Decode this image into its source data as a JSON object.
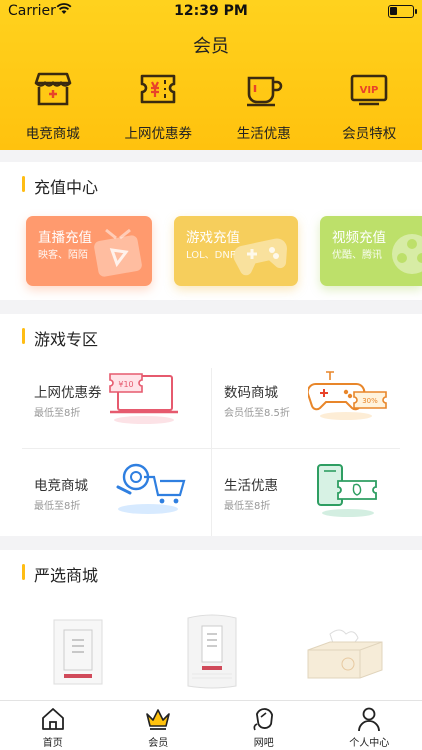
{
  "status_bar": {
    "carrier": "Carrier",
    "time": "12:39 PM"
  },
  "header": {
    "title": "会员",
    "menu": [
      {
        "label": "电竞商城",
        "icon": "store-icon"
      },
      {
        "label": "上网优惠券",
        "icon": "ticket-icon"
      },
      {
        "label": "生活优惠",
        "icon": "coffee-cup-icon"
      },
      {
        "label": "会员特权",
        "icon": "vip-card-icon"
      }
    ]
  },
  "recharge_center": {
    "title": "充值中心",
    "cards": [
      {
        "title": "直播充值",
        "subtitle": "映客、陌陌",
        "color": "#ff9a6e",
        "icon": "tv-play-icon"
      },
      {
        "title": "游戏充值",
        "subtitle": "LOL、DNF",
        "color": "#f6ce5c",
        "icon": "gamepad-icon"
      },
      {
        "title": "视频充值",
        "subtitle": "优酷、腾讯",
        "color": "#bde06a",
        "icon": "film-reel-icon"
      }
    ]
  },
  "game_zone": {
    "title": "游戏专区",
    "items": [
      {
        "title": "上网优惠券",
        "subtitle": "最低至8折",
        "icon": "laptop-coupon-icon",
        "badge": "¥10"
      },
      {
        "title": "数码商城",
        "subtitle": "会员低至8.5折",
        "icon": "gamepad-coupon-icon",
        "badge": "30%"
      },
      {
        "title": "电竞商城",
        "subtitle": "最低至8折",
        "icon": "steam-cart-icon"
      },
      {
        "title": "生活优惠",
        "subtitle": "最低至8折",
        "icon": "phone-coupon-icon"
      }
    ]
  },
  "selected_mall": {
    "title": "严选商城"
  },
  "tabbar": [
    {
      "label": "首页",
      "icon": "home-icon"
    },
    {
      "label": "会员",
      "icon": "crown-icon",
      "active": true
    },
    {
      "label": "网吧",
      "icon": "mouse-icon"
    },
    {
      "label": "个人中心",
      "icon": "person-icon"
    }
  ],
  "colors": {
    "brand": "#ffc20e",
    "accent": "#ffbd14"
  }
}
